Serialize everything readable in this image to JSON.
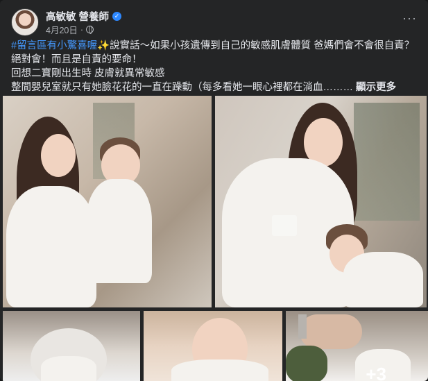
{
  "post": {
    "author": "高敏敏 營養師",
    "date": "4月20日",
    "dot": "·",
    "more_label": "···",
    "lines": [
      {
        "hashtag": "#留言區有小驚喜喔",
        "emoji": "✨",
        "text": "說實話～如果小孩遺傳到自己的敏感肌膚體質 爸媽們會不會很自責？"
      },
      {
        "text": "絕對會！而且是自責的要命！"
      },
      {
        "text": "回想二寶剛出生時 皮膚就異常敏感"
      },
      {
        "text": "整間嬰兒室就只有她臉花花的一直在躁動（每多看她一眼心裡都在淌血……… ",
        "see_more": "顯示更多"
      }
    ],
    "extra_photos_count": "+3"
  },
  "colors": {
    "background": "#242526",
    "text": "#e4e6eb",
    "secondary": "#b0b3b8",
    "link": "#4599ff",
    "verified": "#2d88ff"
  },
  "icons": {
    "verified": "verified-badge-icon",
    "privacy": "globe-icon",
    "menu": "more-options-icon"
  }
}
